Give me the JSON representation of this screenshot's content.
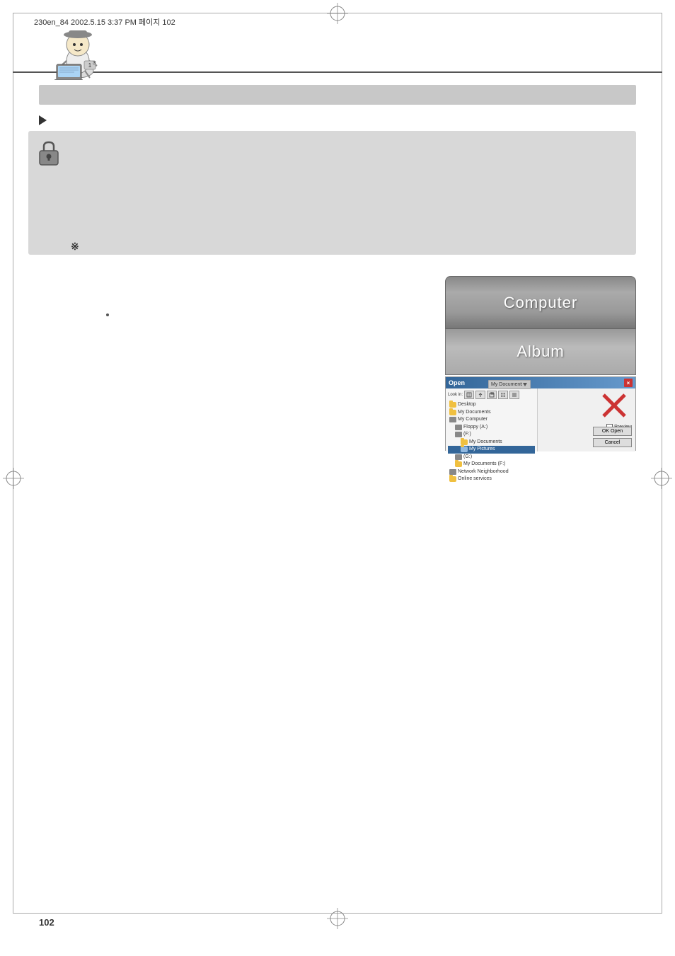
{
  "page": {
    "header_text": "230en_84  2002.5.15  3:37 PM  페이지 102",
    "page_number": "102"
  },
  "computer_label": "Computer",
  "album_label": "Album",
  "dialog": {
    "title": "Open",
    "close_button": "×",
    "lookup_label": "Look in:",
    "lookup_path": "My Documents (F:)",
    "folder_items": [
      "Desktop",
      "My Documents",
      "My Computer",
      "Floppy (A:)",
      "(F:)",
      "My Documents",
      "My Pictures",
      "(G:)",
      "My Documents (F:)",
      "Network Neighborhood",
      "Online services"
    ],
    "checkbox_label": "Preview",
    "ok_button": "OK Open",
    "cancel_button": "Cancel"
  },
  "icons": {
    "triangle_bullet": "▶",
    "asterisk": "※",
    "dot": "·"
  }
}
